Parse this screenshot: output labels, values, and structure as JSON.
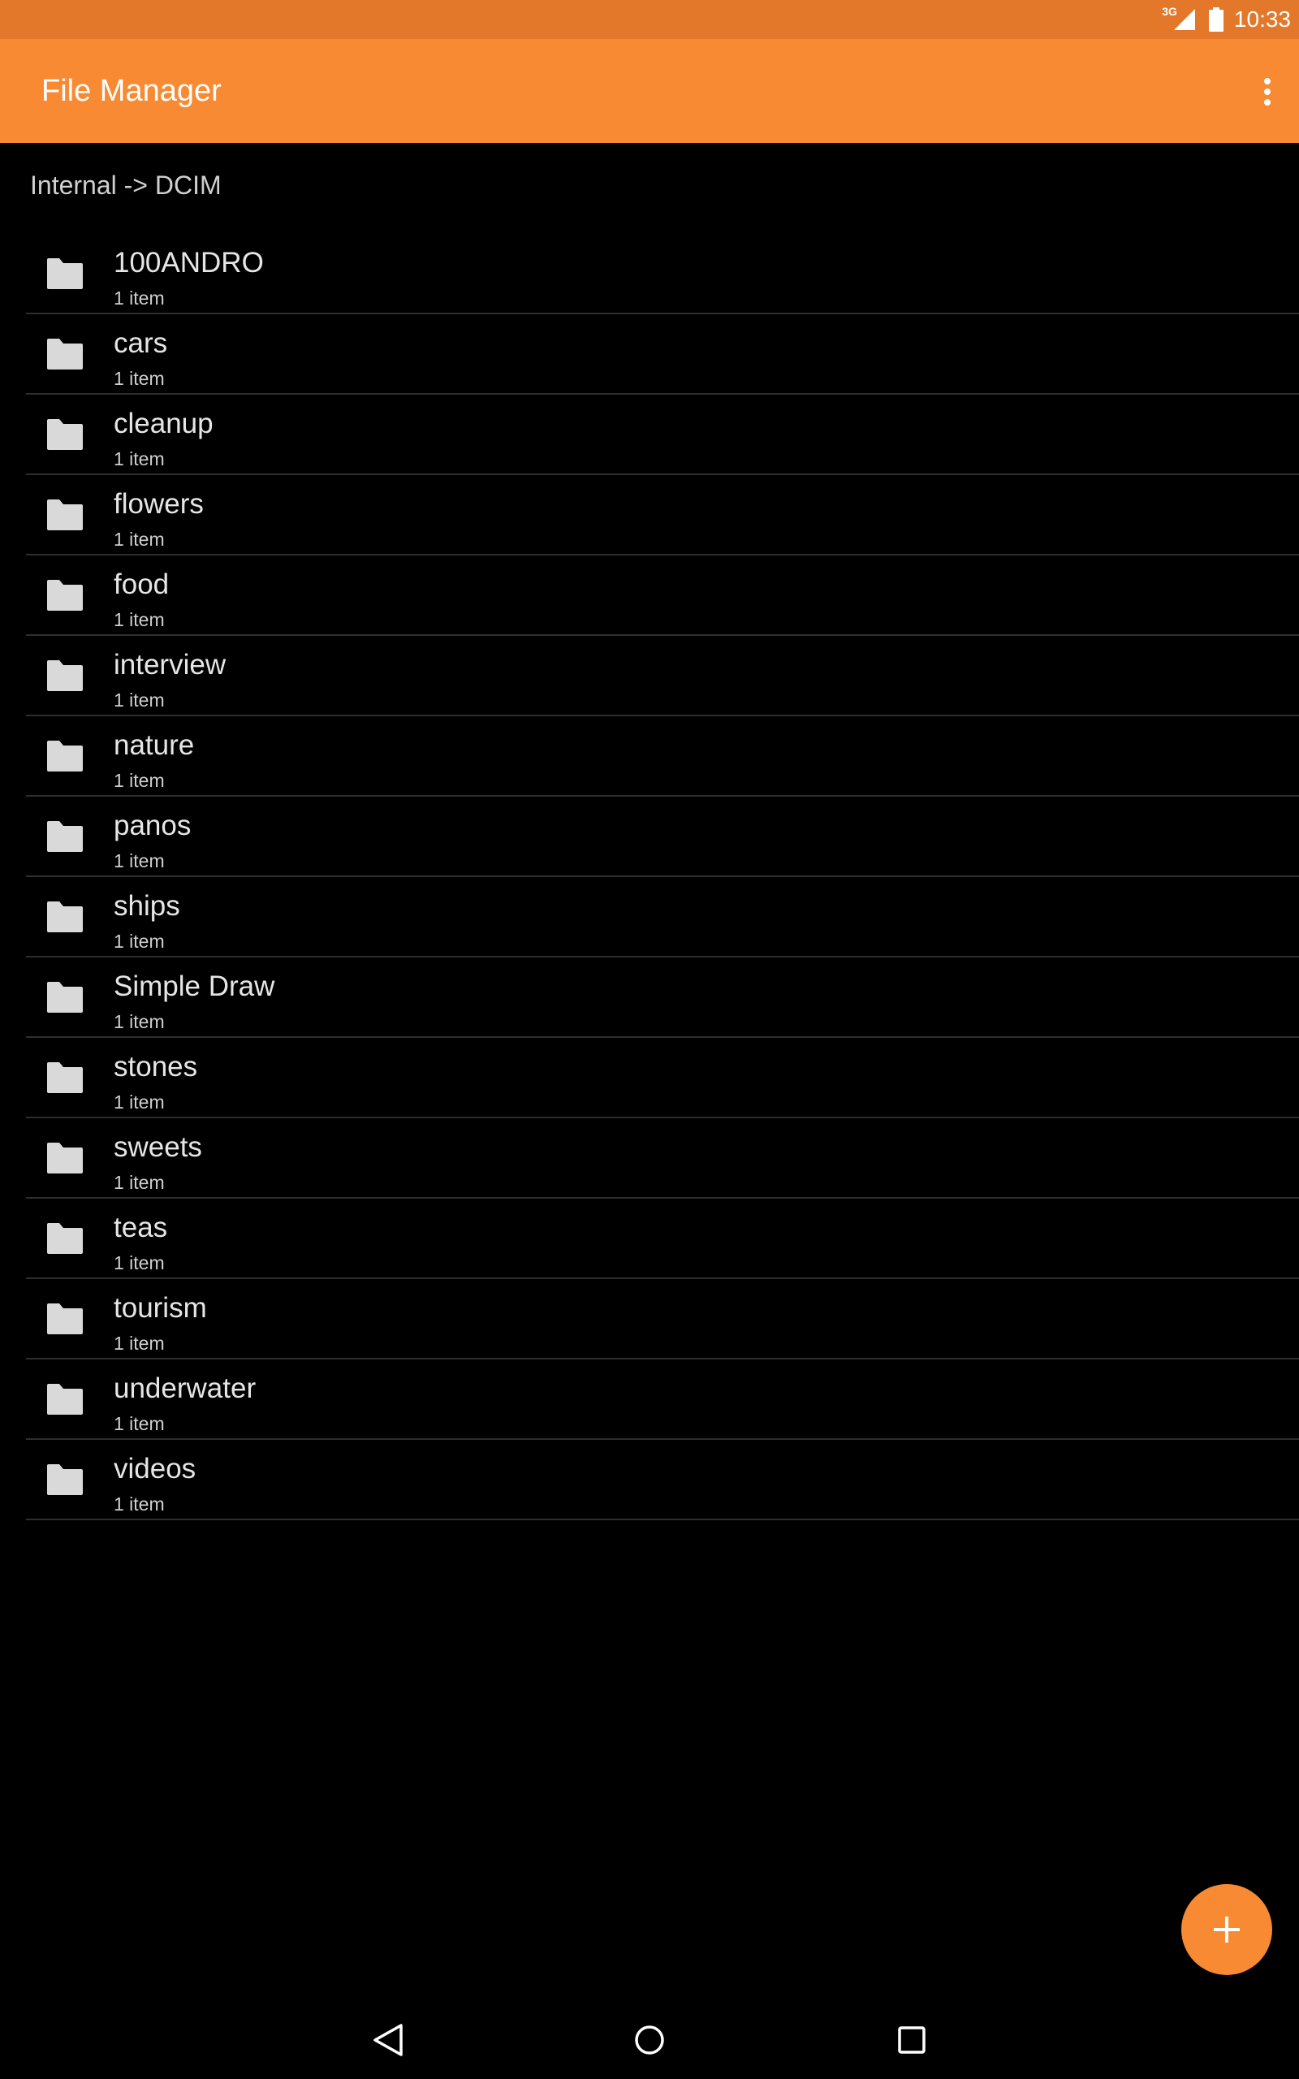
{
  "status_bar": {
    "network": "3G",
    "time": "10:33"
  },
  "app_bar": {
    "title": "File Manager",
    "menu_icon": "more-vert-icon"
  },
  "breadcrumb": "Internal -> DCIM",
  "folders": [
    {
      "name": "100ANDRO",
      "count": "1 item"
    },
    {
      "name": "cars",
      "count": "1 item"
    },
    {
      "name": "cleanup",
      "count": "1 item"
    },
    {
      "name": "flowers",
      "count": "1 item"
    },
    {
      "name": "food",
      "count": "1 item"
    },
    {
      "name": "interview",
      "count": "1 item"
    },
    {
      "name": "nature",
      "count": "1 item"
    },
    {
      "name": "panos",
      "count": "1 item"
    },
    {
      "name": "ships",
      "count": "1 item"
    },
    {
      "name": "Simple Draw",
      "count": "1 item"
    },
    {
      "name": "stones",
      "count": "1 item"
    },
    {
      "name": "sweets",
      "count": "1 item"
    },
    {
      "name": "teas",
      "count": "1 item"
    },
    {
      "name": "tourism",
      "count": "1 item"
    },
    {
      "name": "underwater",
      "count": "1 item"
    },
    {
      "name": "videos",
      "count": "1 item"
    }
  ],
  "fab": {
    "icon": "plus-icon"
  },
  "nav_bar": {
    "icons": [
      "back-icon",
      "home-icon",
      "recents-icon"
    ]
  },
  "colors": {
    "status_bar": "#e4782a",
    "app_bar": "#f78a33",
    "accent": "#f78a33",
    "background": "#000000",
    "folder_icon": "#d9d9d9"
  }
}
